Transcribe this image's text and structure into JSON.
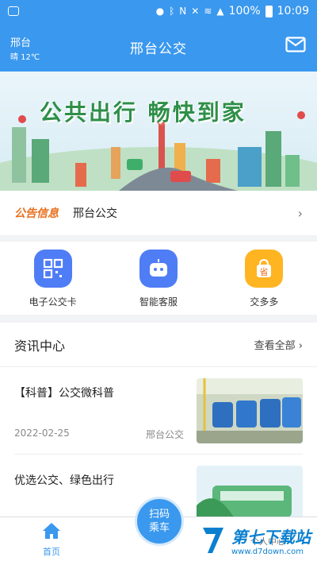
{
  "status_bar": {
    "battery": "100%",
    "time": "10:09",
    "icons": [
      "location-icon",
      "bluetooth-icon",
      "nfc-icon",
      "mute-icon",
      "wifi-icon",
      "signal-icon",
      "battery-icon"
    ]
  },
  "header": {
    "city": "邢台",
    "weather": "晴 12℃",
    "title": "邢台公交",
    "mail_icon": "mail-icon"
  },
  "banner": {
    "slogan": "公共出行  畅快到家"
  },
  "notice": {
    "tag": "公告信息",
    "text": "邢台公交"
  },
  "quick_actions": [
    {
      "label": "电子公交卡",
      "icon": "qr-card-icon",
      "color": "#4f7df5"
    },
    {
      "label": "智能客服",
      "icon": "robot-icon",
      "color": "#4f7df5"
    },
    {
      "label": "交多多",
      "icon": "shopping-bag-icon",
      "color": "#ffb422"
    }
  ],
  "news": {
    "title": "资讯中心",
    "view_all": "查看全部",
    "items": [
      {
        "title": "【科普】公交微科普",
        "date": "2022-02-25",
        "source": "邢台公交"
      },
      {
        "title": "优选公交、绿色出行",
        "date": "",
        "source": ""
      }
    ]
  },
  "tabbar": {
    "home": "首页",
    "scan_line1": "扫码",
    "scan_line2": "乘车",
    "me": "个人中心"
  },
  "watermark": {
    "main": "第七下载站",
    "url": "www.d7down.com"
  },
  "colors": {
    "primary": "#3a98ee",
    "notice_tag": "#e8701e",
    "slogan": "#2e8f49"
  }
}
